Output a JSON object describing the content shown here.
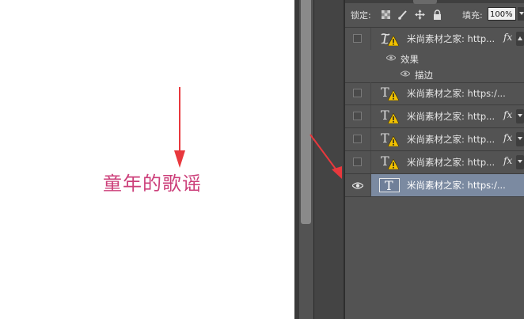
{
  "canvas": {
    "text": "童年的歌谣",
    "text_color": "#cc3f7a",
    "arrow_color": "#e8383d"
  },
  "layers_panel": {
    "lock_label": "锁定:",
    "lock_icons": [
      "lock-transparent-pixels-icon",
      "lock-image-pixels-icon",
      "lock-position-icon",
      "lock-all-icon"
    ],
    "fill_label": "填充:",
    "fill_value": "100%",
    "layers": [
      {
        "name": "米尚素材之家: http...",
        "type": "text-warped",
        "warning": true,
        "fx": "fx",
        "visible": false,
        "effects_expanded": true
      },
      {
        "name": "米尚素材之家: https:/...",
        "type": "text",
        "warning": true,
        "fx": "",
        "visible": false
      },
      {
        "name": "米尚素材之家: http...",
        "type": "text",
        "warning": true,
        "fx": "fx",
        "visible": false
      },
      {
        "name": "米尚素材之家: http...",
        "type": "text",
        "warning": true,
        "fx": "fx",
        "visible": false
      },
      {
        "name": "米尚素材之家: http...",
        "type": "text",
        "warning": true,
        "fx": "fx",
        "visible": false
      },
      {
        "name": "米尚素材之家: https:/...",
        "type": "text",
        "warning": false,
        "fx": "",
        "visible": true,
        "selected": true
      }
    ],
    "effects_label": "效果",
    "stroke_label": "描边",
    "selected_color": "#7b8aa1"
  }
}
